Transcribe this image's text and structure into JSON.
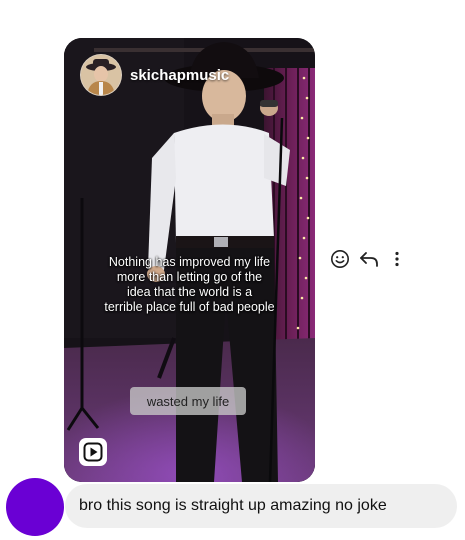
{
  "post": {
    "username": "skichapmusic",
    "caption_lines": [
      "Nothing has improved my life",
      "more than letting go of the",
      "idea that the world is a",
      "terrible place full of bad people"
    ],
    "sticker_text": "wasted my life",
    "reel_icon": "reels-play-icon"
  },
  "actions": {
    "icons": [
      "emoji-react-icon",
      "reply-arrow-icon",
      "more-options-icon"
    ]
  },
  "message": {
    "text": "bro this song is straight up amazing no joke",
    "avatar_color": "#6a00d4"
  },
  "colors": {
    "bubble_bg": "#efefef",
    "avatar_purple": "#6a00d4"
  }
}
